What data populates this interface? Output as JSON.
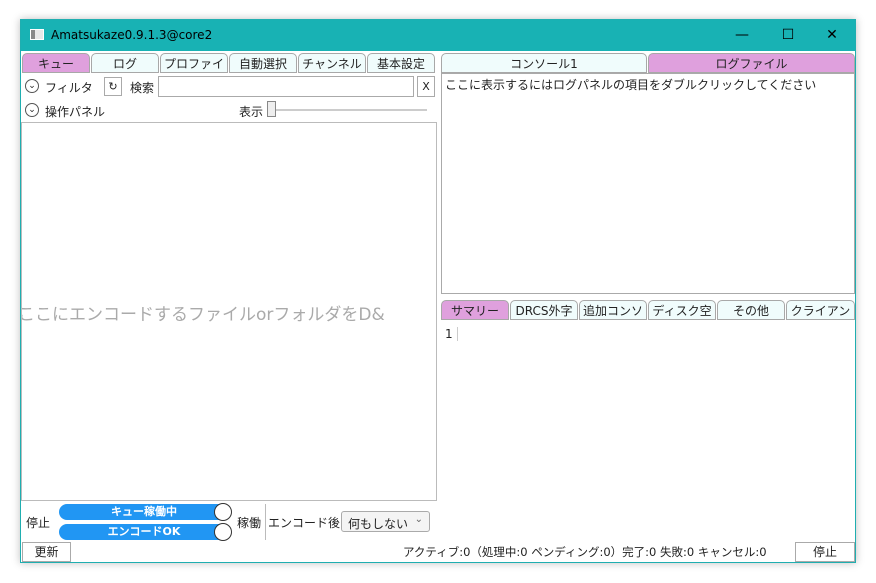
{
  "window": {
    "title": "Amatsukaze0.9.1.3@core2"
  },
  "window_controls": {
    "minimize": "—",
    "maximize": "☐",
    "close": "✕"
  },
  "left_tabs": [
    "キュー",
    "ログ",
    "プロファイ",
    "自動選択",
    "チャンネル",
    "基本設定"
  ],
  "filter": {
    "label": "フィルタ",
    "refresh": "↻",
    "search_label": "検索",
    "search_value": "",
    "clear": "X"
  },
  "panel": {
    "label": "操作パネル",
    "display_label": "表示"
  },
  "drop_hint": "ここにエンコードするファイルorフォルダをD&",
  "controls": {
    "stop_label": "停止",
    "queue_toggle": "キュー稼働中",
    "encode_toggle": "エンコードOK",
    "run_label": "稼働",
    "after_encode_label": "エンコード後",
    "after_encode_value": "何もしない"
  },
  "footer": {
    "refresh_button": "更新",
    "status": "アクティブ:0（処理中:0 ペンディング:0）完了:0 失敗:0 キャンセル:0",
    "stop_button": "停止"
  },
  "right_top_tabs": [
    "コンソール1",
    "ログファイル"
  ],
  "log_hint": "ここに表示するにはログパネルの項目をダブルクリックしてください",
  "right_bottom_tabs": [
    "サマリー",
    "DRCS外字",
    "追加コンソ",
    "ディスク空",
    "その他",
    "クライアン"
  ],
  "summary": {
    "line_number": "1"
  },
  "colors": {
    "titlebar": "#18b2b4",
    "active_tab": "#dfa0dd",
    "toggle": "#2196f3"
  }
}
